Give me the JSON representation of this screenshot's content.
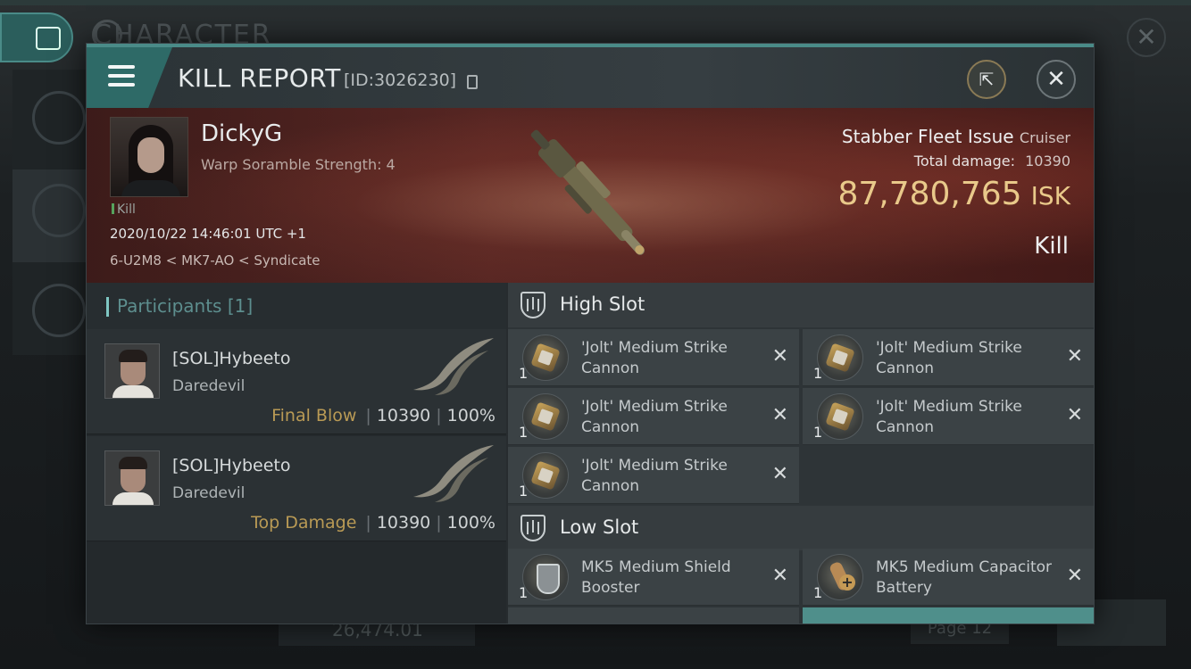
{
  "background": {
    "title": "CHARACTER",
    "bottom_value": "26,474.01",
    "page_label": "Page 12"
  },
  "header": {
    "title": "KILL REPORT",
    "id_text": "[ID:3026230]"
  },
  "victim": {
    "name": "DickyG",
    "scramble": "Warp Soramble Strength: 4",
    "tag": "Kill",
    "time": "2020/10/22 14:46:01 UTC +1",
    "location": "6-U2M8 < MK7-AO < Syndicate",
    "ship_name": "Stabber Fleet Issue",
    "ship_class": "Cruiser",
    "total_damage_label": "Total damage:",
    "total_damage": "10390",
    "isk_value": "87,780,765",
    "isk_unit": "ISK",
    "type": "Kill"
  },
  "participants": {
    "label": "Participants [1]",
    "rows": [
      {
        "name": "[SOL]Hybeeto",
        "ship": "Daredevil",
        "role": "Final Blow",
        "damage": "10390",
        "percent": "100%"
      },
      {
        "name": "[SOL]Hybeeto",
        "ship": "Daredevil",
        "role": "Top Damage",
        "damage": "10390",
        "percent": "100%"
      }
    ]
  },
  "fitting": {
    "high_slot_label": "High Slot",
    "low_slot_label": "Low Slot",
    "high": [
      {
        "qty": "1",
        "name": "'Jolt' Medium Strike Cannon",
        "icon": "cannon-icon"
      },
      {
        "qty": "1",
        "name": "'Jolt' Medium Strike Cannon",
        "icon": "cannon-icon"
      },
      {
        "qty": "1",
        "name": "'Jolt' Medium Strike Cannon",
        "icon": "cannon-icon"
      },
      {
        "qty": "1",
        "name": "'Jolt' Medium Strike Cannon",
        "icon": "cannon-icon"
      },
      {
        "qty": "1",
        "name": "'Jolt' Medium Strike Cannon",
        "icon": "cannon-icon"
      }
    ],
    "low": [
      {
        "qty": "1",
        "name": "MK5 Medium Shield Booster",
        "icon": "shield-booster-icon"
      },
      {
        "qty": "1",
        "name": "MK5 Medium Capacitor Battery",
        "icon": "capacitor-battery-icon"
      }
    ]
  },
  "colors": {
    "accent": "#4a8b88",
    "isk": "#e9c98a",
    "role": "#b99a55"
  }
}
